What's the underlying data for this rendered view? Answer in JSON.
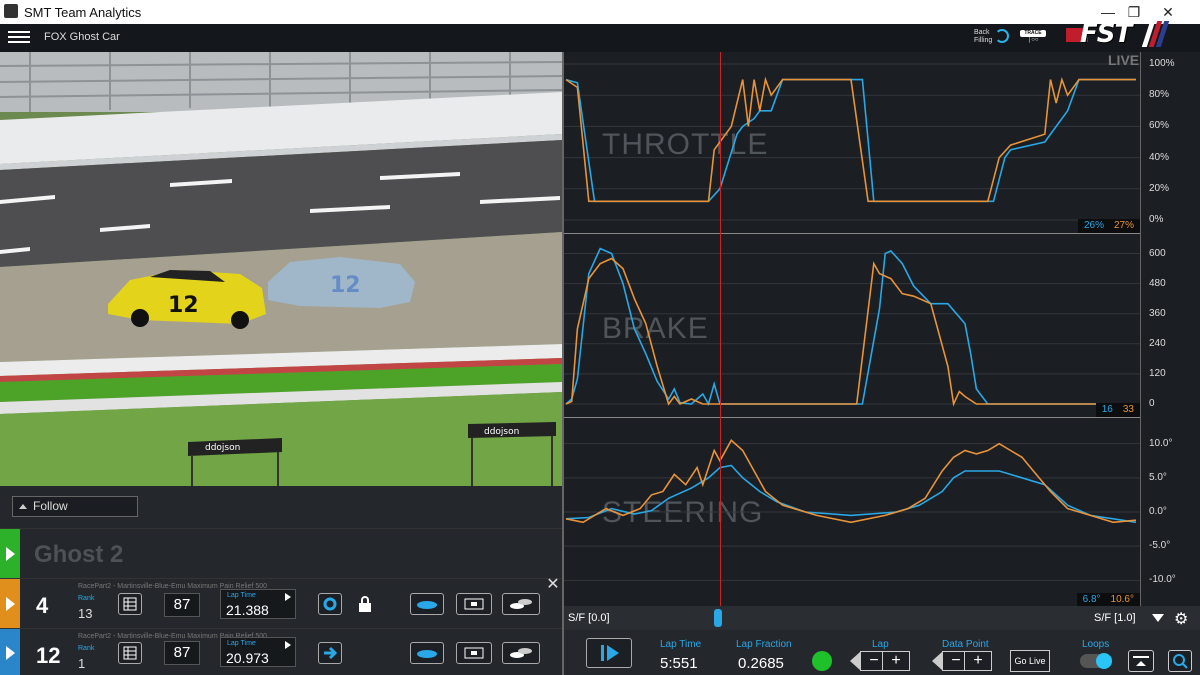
{
  "window": {
    "title": "SMT Team Analytics"
  },
  "header": {
    "subtitle": "FOX Ghost Car",
    "back_filling": "Back Filling",
    "trace_label": "TRACE",
    "logo_text": "FST"
  },
  "video": {
    "follow_label": "Follow",
    "banner_text": "ddojson"
  },
  "ghost_row": {
    "name": "Ghost 2"
  },
  "cars": [
    {
      "number": "4",
      "title": "RacePart2 - Martinsville-Blue-Emu Maximum Pain Relief 500",
      "rank_label": "Rank",
      "rank": "13",
      "value": "87",
      "lap_time_label": "Lap Time",
      "lap_time": "21.388",
      "color": "#e18f1c"
    },
    {
      "number": "12",
      "title": "RacePart2 - Martinsville-Blue-Emu Maximum Pain Relief 500",
      "rank_label": "Rank",
      "rank": "1",
      "value": "87",
      "lap_time_label": "Lap Time",
      "lap_time": "20.973",
      "color": "#2a86c8"
    }
  ],
  "live_label": "LIVE",
  "scrub": {
    "start_label": "S/F [0.0]",
    "end_label": "S/F [1.0]",
    "position": 0.27
  },
  "bottom": {
    "lap_time_label": "Lap Time",
    "lap_time": "5:551",
    "lap_fraction_label": "Lap Fraction",
    "lap_fraction": "0.2685",
    "lap_label": "Lap",
    "data_point_label": "Data Point",
    "go_live": "Go Live",
    "loops_label": "Loops"
  },
  "chart_data": [
    {
      "type": "line",
      "title": "THROTTLE",
      "ylim": [
        0,
        100
      ],
      "yticks": [
        "0%",
        "20%",
        "40%",
        "60%",
        "80%",
        "100%"
      ],
      "legend": {
        "blue": "26%",
        "orange": "27%"
      },
      "series": [
        {
          "name": "blue",
          "color": "#29a7e6",
          "x": [
            0,
            0.02,
            0.05,
            0.25,
            0.27,
            0.3,
            0.31,
            0.33,
            0.34,
            0.36,
            0.38,
            0.4,
            0.52,
            0.54,
            0.75,
            0.77,
            0.78,
            0.84,
            0.86,
            0.88,
            0.9,
            0.92,
            0.94,
            1.0
          ],
          "y": [
            90,
            88,
            12,
            12,
            20,
            55,
            60,
            65,
            70,
            70,
            90,
            90,
            90,
            12,
            12,
            40,
            45,
            50,
            60,
            70,
            90,
            90,
            90,
            90
          ]
        },
        {
          "name": "orange",
          "color": "#e8933a",
          "x": [
            0,
            0.02,
            0.04,
            0.25,
            0.26,
            0.29,
            0.31,
            0.32,
            0.33,
            0.34,
            0.35,
            0.36,
            0.38,
            0.5,
            0.53,
            0.74,
            0.76,
            0.78,
            0.84,
            0.85,
            0.86,
            0.87,
            0.88,
            0.9,
            1.0
          ],
          "y": [
            90,
            85,
            12,
            12,
            45,
            60,
            90,
            60,
            90,
            70,
            90,
            80,
            90,
            90,
            12,
            12,
            40,
            48,
            55,
            90,
            75,
            90,
            80,
            90,
            90
          ]
        }
      ]
    },
    {
      "type": "line",
      "title": "BRAKE",
      "ylim": [
        0,
        630
      ],
      "yticks": [
        "0",
        "120",
        "240",
        "360",
        "480",
        "600"
      ],
      "legend": {
        "blue": "16",
        "orange": "33"
      },
      "series": [
        {
          "name": "blue",
          "color": "#29a7e6",
          "x": [
            0,
            0.01,
            0.02,
            0.04,
            0.06,
            0.08,
            0.1,
            0.12,
            0.14,
            0.16,
            0.18,
            0.19,
            0.2,
            0.22,
            0.24,
            0.25,
            0.26,
            0.27,
            0.3,
            0.45,
            0.52,
            0.55,
            0.56,
            0.57,
            0.59,
            0.61,
            0.64,
            0.67,
            0.7,
            0.71,
            0.72,
            0.74,
            0.76,
            1.0
          ],
          "y": [
            0,
            20,
            100,
            520,
            620,
            600,
            480,
            300,
            200,
            90,
            20,
            60,
            5,
            0,
            40,
            0,
            80,
            0,
            0,
            0,
            0,
            380,
            600,
            610,
            560,
            470,
            400,
            400,
            320,
            200,
            60,
            0,
            0,
            0
          ]
        },
        {
          "name": "orange",
          "color": "#e8933a",
          "x": [
            0,
            0.01,
            0.02,
            0.04,
            0.06,
            0.08,
            0.1,
            0.12,
            0.14,
            0.16,
            0.18,
            0.19,
            0.2,
            0.22,
            0.24,
            0.25,
            0.3,
            0.45,
            0.51,
            0.54,
            0.55,
            0.57,
            0.59,
            0.61,
            0.64,
            0.67,
            0.68,
            0.69,
            0.7,
            0.72,
            1.0
          ],
          "y": [
            0,
            10,
            300,
            500,
            560,
            580,
            540,
            420,
            320,
            150,
            0,
            30,
            0,
            20,
            0,
            0,
            0,
            0,
            0,
            560,
            520,
            500,
            440,
            430,
            400,
            150,
            0,
            50,
            30,
            0,
            0
          ]
        }
      ]
    },
    {
      "type": "line",
      "title": "STEERING",
      "ylim": [
        -12,
        12
      ],
      "yticks": [
        "-10.0°",
        "-5.0°",
        "0.0°",
        "5.0°",
        "10.0°"
      ],
      "legend": {
        "blue": "6.8°",
        "orange": "10.6°"
      },
      "series": [
        {
          "name": "blue",
          "color": "#29a7e6",
          "x": [
            0,
            0.04,
            0.08,
            0.12,
            0.15,
            0.18,
            0.22,
            0.25,
            0.27,
            0.29,
            0.31,
            0.34,
            0.37,
            0.42,
            0.5,
            0.58,
            0.62,
            0.66,
            0.68,
            0.7,
            0.72,
            0.76,
            0.8,
            0.84,
            0.88,
            0.92,
            0.96,
            1.0
          ],
          "y": [
            -1,
            -0.8,
            0.5,
            -0.3,
            0.2,
            2,
            3.5,
            5,
            6.5,
            6.8,
            5,
            3,
            1.5,
            0,
            -0.5,
            0,
            1,
            3,
            5,
            6,
            6,
            6,
            5,
            4,
            1,
            -0.5,
            -1,
            -1.5
          ]
        },
        {
          "name": "orange",
          "color": "#e8933a",
          "x": [
            0,
            0.03,
            0.07,
            0.1,
            0.13,
            0.15,
            0.17,
            0.19,
            0.21,
            0.23,
            0.24,
            0.26,
            0.27,
            0.29,
            0.31,
            0.33,
            0.35,
            0.38,
            0.44,
            0.5,
            0.56,
            0.6,
            0.63,
            0.66,
            0.68,
            0.7,
            0.72,
            0.74,
            0.76,
            0.78,
            0.8,
            0.82,
            0.85,
            0.88,
            0.92,
            0.96,
            1.0
          ],
          "y": [
            -1,
            -1.5,
            0.5,
            -0.5,
            0.5,
            2.5,
            3,
            5.5,
            4,
            6.5,
            4,
            9,
            7.5,
            10.5,
            9,
            6,
            3,
            1,
            -0.5,
            -1.5,
            -0.5,
            0.5,
            2,
            6,
            8,
            9,
            8.5,
            9,
            10,
            9,
            8,
            6,
            3,
            0.5,
            -0.5,
            -1.5,
            -1.2
          ]
        }
      ]
    }
  ]
}
